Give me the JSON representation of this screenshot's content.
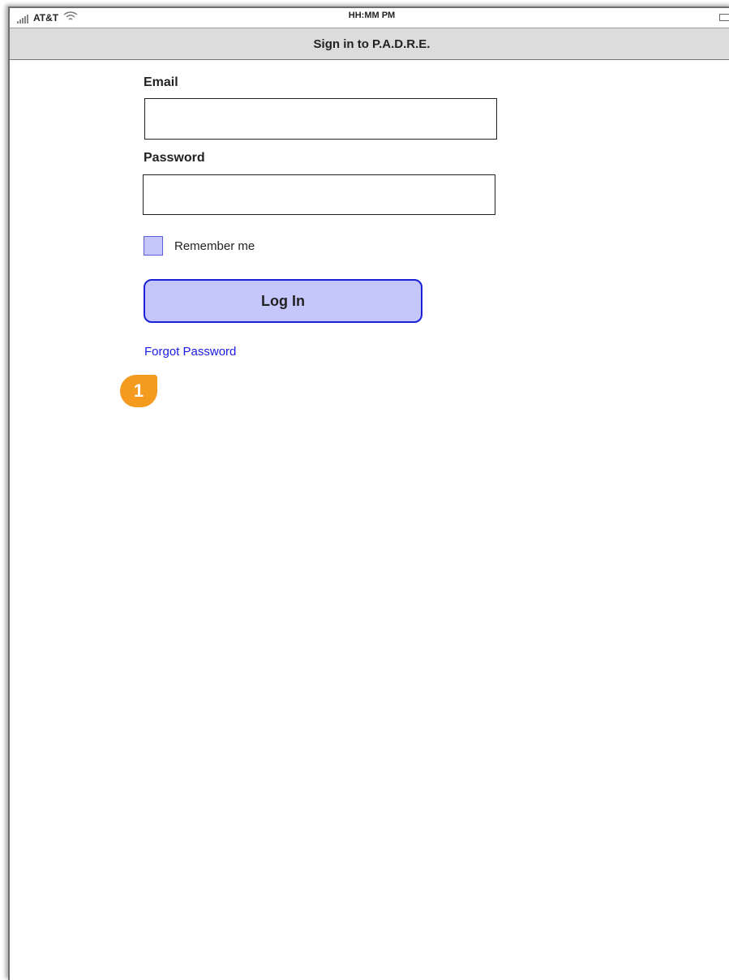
{
  "status_bar": {
    "carrier": "AT&T",
    "time": "HH:MM PM",
    "icons": [
      "signal-bars-icon",
      "wifi-icon",
      "battery-icon"
    ]
  },
  "nav": {
    "title": "Sign in to P.A.D.R.E."
  },
  "form": {
    "email_label": "Email",
    "email_value": "",
    "password_label": "Password",
    "password_value": "",
    "remember_label": "Remember me",
    "remember_checked": false,
    "login_label": "Log In",
    "forgot_label": "Forgot Password"
  },
  "annotation": {
    "number": "1"
  },
  "colors": {
    "accent_fill": "#c5c6fb",
    "button_border": "#1b22d6",
    "link": "#1a1ae6",
    "callout": "#f39a1f",
    "navbar": "#dcdcdc"
  }
}
